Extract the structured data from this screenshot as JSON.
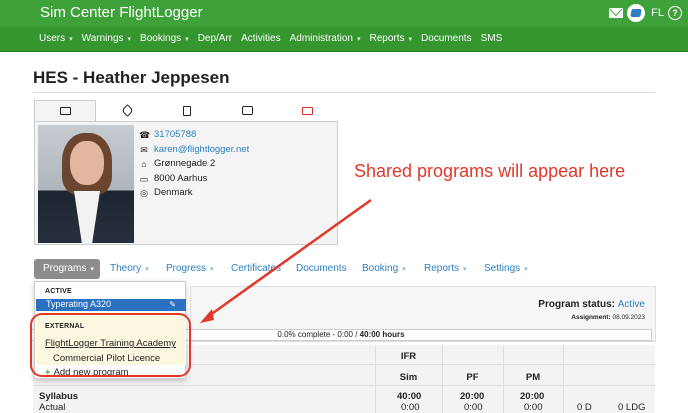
{
  "app": {
    "title": "Sim Center FlightLogger",
    "user_initials": "FL",
    "help": "?"
  },
  "nav": {
    "items": [
      {
        "label": "Users",
        "caret": "▾"
      },
      {
        "label": "Warnings",
        "caret": "▾"
      },
      {
        "label": "Bookings",
        "caret": "▾"
      },
      {
        "label": "Dep/Arr",
        "caret": ""
      },
      {
        "label": "Activities",
        "caret": ""
      },
      {
        "label": "Administration",
        "caret": "▾"
      },
      {
        "label": "Reports",
        "caret": "▾"
      },
      {
        "label": "Documents",
        "caret": ""
      },
      {
        "label": "SMS",
        "caret": ""
      }
    ]
  },
  "person": {
    "name": "HES - Heather Jeppesen"
  },
  "profile_tabs": [
    "id-card-icon",
    "tag-icon",
    "clipboard-icon",
    "chat-icon",
    "id-card-red-icon"
  ],
  "contact": {
    "phone": "31705788",
    "email": "karen@flightlogger.net",
    "street": "Grønnegade 2",
    "city": "8000 Aarhus",
    "country": "Denmark"
  },
  "annotation": {
    "text": "Shared programs will appear here",
    "color": "#e0382a"
  },
  "subnav": {
    "items": [
      {
        "label": "Programs",
        "caret": "▾",
        "active": true
      },
      {
        "label": "Theory",
        "caret": "▾"
      },
      {
        "label": "Progress",
        "caret": "▾"
      },
      {
        "label": "Certificates",
        "caret": ""
      },
      {
        "label": "Documents",
        "caret": ""
      },
      {
        "label": "Booking",
        "caret": "▾"
      },
      {
        "label": "Reports",
        "caret": "▾"
      },
      {
        "label": "Settings",
        "caret": "▾"
      }
    ]
  },
  "dropdown": {
    "active_header": "ACTIVE",
    "active_item": "Typerating A320",
    "external_header": "EXTERNAL",
    "external_link": "FlightLogger Training Academy",
    "external_sub": "Commercial Pilot Licence",
    "add_label": "Add new program"
  },
  "program": {
    "status_label": "Program status:",
    "status_value": "Active",
    "assignment_label": "Assignment:",
    "assignment_date": "08.09.2023",
    "progress_text": "0.0% complete - 0:00 / ",
    "progress_hours": "40:00 hours",
    "progress_fraction": 0.0
  },
  "grid": {
    "ifr": "IFR",
    "headers": [
      "Sim",
      "PF",
      "PM"
    ],
    "rows": [
      {
        "label": "Syllabus",
        "values": [
          "40:00",
          "20:00",
          "20:00",
          "",
          ""
        ]
      },
      {
        "label": "Actual",
        "values": [
          "0:00",
          "0:00",
          "0:00",
          "0 D",
          "0 LDG"
        ]
      }
    ]
  },
  "colors": {
    "green": "#3ea13a",
    "blue": "#2a7fc1",
    "red": "#e0382a"
  }
}
